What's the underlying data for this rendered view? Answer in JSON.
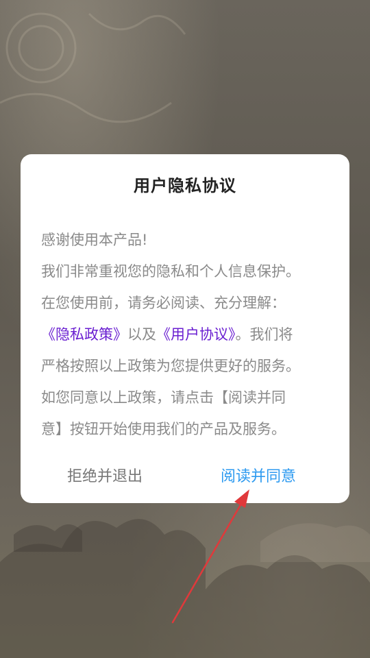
{
  "dialog": {
    "title": "用户隐私协议",
    "body": {
      "line1": "感谢使用本产品!",
      "line2": "我们非常重视您的隐私和个人信息保护。",
      "line3": "在您使用前，请务必阅读、充分理解：",
      "privacy_policy_link": "《隐私政策》",
      "and_text": "以及",
      "user_agreement_link": "《用户协议》",
      "line4_tail": "。我们将",
      "line5": "严格按照以上政策为您提供更好的服务。",
      "line6": "如您同意以上政策，请点击【阅读并同",
      "line7": "意】按钮开始使用我们的产品及服务。"
    },
    "decline_label": "拒绝并退出",
    "agree_label": "阅读并同意"
  },
  "colors": {
    "link": "#6a1fd1",
    "agree": "#2d9af0",
    "annotation_arrow": "#e0393b"
  }
}
